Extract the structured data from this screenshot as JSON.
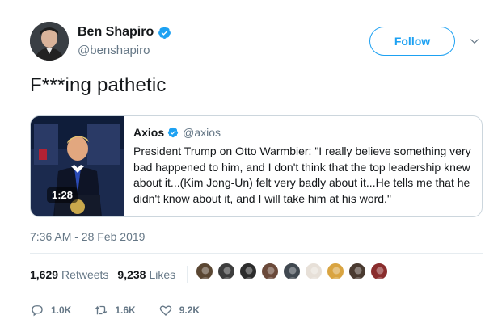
{
  "author": {
    "name": "Ben Shapiro",
    "handle": "@benshapiro",
    "verified": true
  },
  "follow_button": {
    "label": "Follow"
  },
  "tweet": {
    "text": "F***ing pathetic",
    "timestamp": "7:36 AM - 28 Feb 2019"
  },
  "quoted_tweet": {
    "name": "Axios",
    "handle": "@axios",
    "verified": true,
    "video_duration": "1:28",
    "text": "President Trump on Otto Warmbier: \"I really believe something very bad happened to him, and I don't think that the top leadership knew about it...(Kim Jong-Un) felt very badly about it...He tells me that he didn't know about it, and I will take him at his word.\""
  },
  "stats": {
    "retweets_count": "1,629",
    "retweets_label": "Retweets",
    "likes_count": "9,238",
    "likes_label": "Likes",
    "liker_avatar_count": 9
  },
  "actions": {
    "reply_count": "1.0K",
    "retweet_count": "1.6K",
    "like_count": "9.2K"
  },
  "colors": {
    "accent": "#1da1f2",
    "text_primary": "#14171a",
    "text_secondary": "#657786",
    "border": "#ccd6dd"
  },
  "icons": [
    "verified-badge-icon",
    "chevron-down-icon",
    "play-video",
    "reply-icon",
    "retweet-icon",
    "heart-icon"
  ]
}
